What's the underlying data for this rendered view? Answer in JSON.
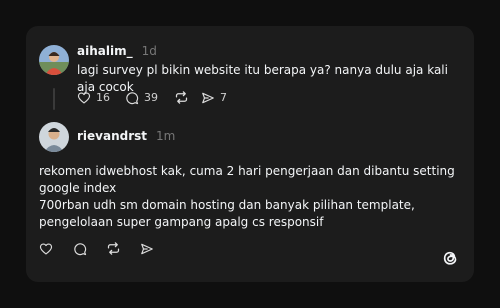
{
  "thread": {
    "post1": {
      "username": "aihalim_",
      "time": "1d",
      "text": "lagi survey pl bikin website itu berapa ya? nanya dulu aja kali aja cocok",
      "likes": "16",
      "replies": "39",
      "shares": "7",
      "avatar_icon": "avatar-photo-icon"
    },
    "post2": {
      "username": "rievandrst",
      "time": "1m",
      "text": "rekomen idwebhost kak, cuma 2 hari pengerjaan dan dibantu setting google index\n700rban udh sm domain hosting dan banyak pilihan template, pengelolaan super gampang apalg cs responsif",
      "avatar_icon": "avatar-photo-icon"
    }
  },
  "icons": {
    "like": "heart-icon",
    "reply": "comment-icon",
    "repost": "repost-icon",
    "share": "send-icon",
    "brand": "threads-logo-icon"
  },
  "colors": {
    "page_bg": "#0f0f0f",
    "card_bg": "#1c1c1c",
    "text": "#f3f5f7",
    "muted": "#777777"
  }
}
